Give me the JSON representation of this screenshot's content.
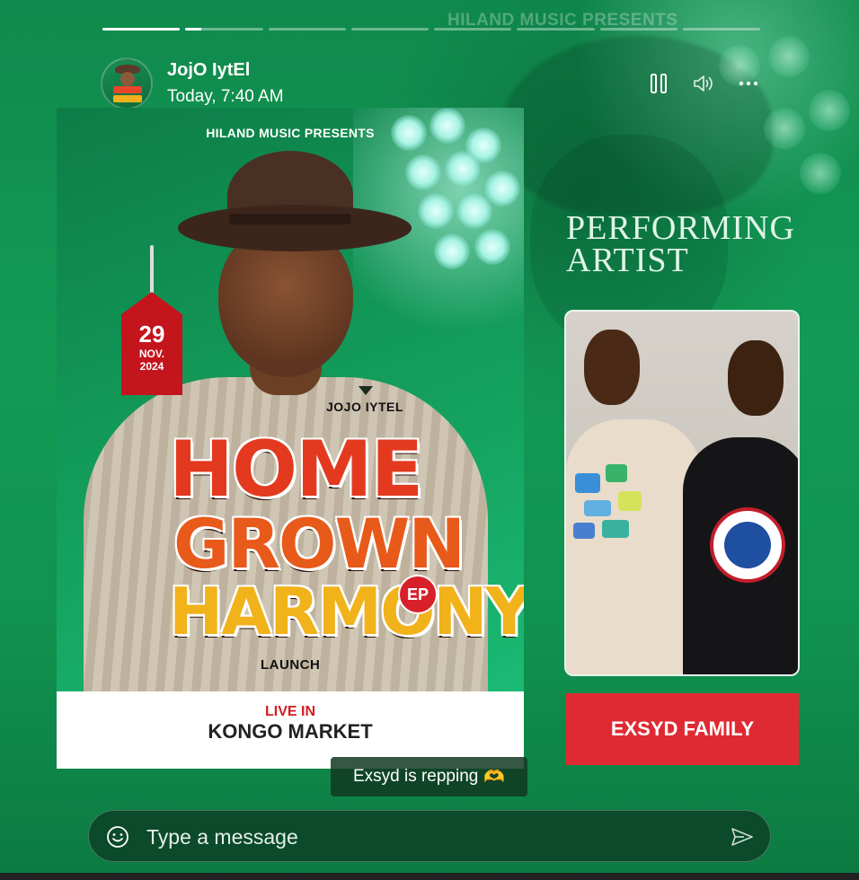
{
  "background": {
    "watermark_text": "HILAND MUSIC PRESENTS"
  },
  "status": {
    "segments": [
      1.0,
      0.2,
      0,
      0,
      0,
      0,
      0,
      0
    ]
  },
  "header": {
    "sender_name": "JojO IytEl",
    "timestamp": "Today, 7:40 AM",
    "icons": {
      "pause": "pause-icon",
      "volume": "volume-icon",
      "more": "more-horizontal-icon"
    }
  },
  "poster": {
    "presenter": "HILAND MUSIC PRESENTS",
    "date": {
      "day": "29",
      "month": "NOV.",
      "year": "2024"
    },
    "artist": "JOJO IYTEL",
    "title_lines": [
      "HOME",
      "GROWN",
      "HARMONY"
    ],
    "badge": "EP",
    "subtitle": "LAUNCH",
    "live_in": "LIVE IN",
    "venue": "KONGO MARKET"
  },
  "side": {
    "heading_line1": "PERFORMING",
    "heading_line2": "ARTIST",
    "group_name": "EXSYD FAMILY"
  },
  "caption": {
    "text": "Exsyd is repping",
    "emoji": "🫶"
  },
  "composer": {
    "placeholder": "Type a message",
    "value": ""
  },
  "colors": {
    "background_green": "#139a55",
    "accent_red": "#e02a33",
    "composer_bg": "#0b4a2b"
  }
}
